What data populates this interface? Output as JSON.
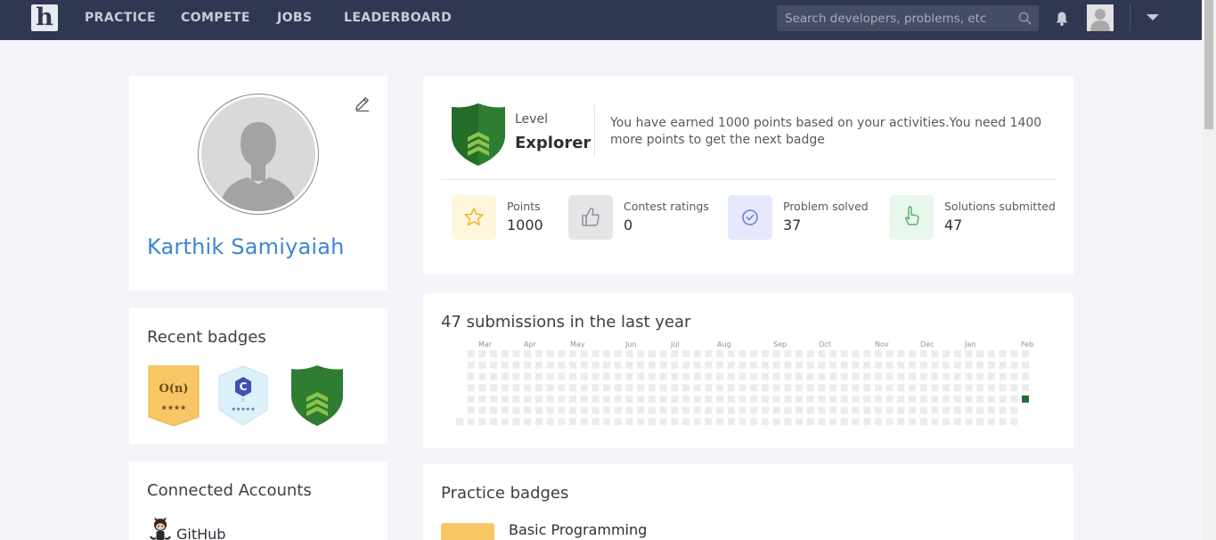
{
  "nav": {
    "logo_letter": "h",
    "links": [
      "PRACTICE",
      "COMPETE",
      "JOBS",
      "LEADERBOARD"
    ],
    "search_placeholder": "Search developers, problems, etc",
    "icons": [
      "search-icon",
      "bell-icon",
      "avatar",
      "chevron-down-icon"
    ],
    "background": "#303753"
  },
  "profile": {
    "name": "Karthik Samiyaiah",
    "name_color": "#3a86d6"
  },
  "recent_badges": {
    "title": "Recent badges",
    "badges": [
      {
        "kind": "complexity",
        "text": "O(n)",
        "stars": "★★★★"
      },
      {
        "kind": "c-language",
        "text": "C",
        "caption": "C",
        "stars": "★★★★★"
      },
      {
        "kind": "level-explorer"
      }
    ]
  },
  "connected_accounts": {
    "title": "Connected Accounts",
    "accounts": [
      {
        "name": "GitHub",
        "icon": "github-octocat-icon"
      }
    ]
  },
  "level": {
    "label": "Level",
    "value": "Explorer",
    "message": "You have earned 1000 points based on your activities.You need 1400 more points to get the next badge",
    "shield_color": "#2e7d32"
  },
  "stats": [
    {
      "label": "Points",
      "value": "1000",
      "icon": "star-icon",
      "bg": "#fff6dc",
      "color": "#f0b429"
    },
    {
      "label": "Contest ratings",
      "value": "0",
      "icon": "thumbs-up-icon",
      "bg": "#e4e5e7",
      "color": "#8a8d93"
    },
    {
      "label": "Problem solved",
      "value": "37",
      "icon": "check-circle-icon",
      "bg": "#e5e9fb",
      "color": "#6a7fdb"
    },
    {
      "label": "Solutions submitted",
      "value": "47",
      "icon": "pointer-hand-icon",
      "bg": "#e8f7ec",
      "color": "#4cb26e"
    }
  ],
  "submissions": {
    "title": "47 submissions in the last year",
    "months": [
      "Mar",
      "Apr",
      "May",
      "Jun",
      "Jul",
      "Aug",
      "Sep",
      "Oct",
      "Nov",
      "Dec",
      "Jan",
      "Feb"
    ],
    "empty_color": "#ececec",
    "active_color": "#216e39"
  },
  "practice_badges": {
    "title": "Practice badges",
    "items": [
      {
        "name": "Basic Programming"
      }
    ]
  }
}
